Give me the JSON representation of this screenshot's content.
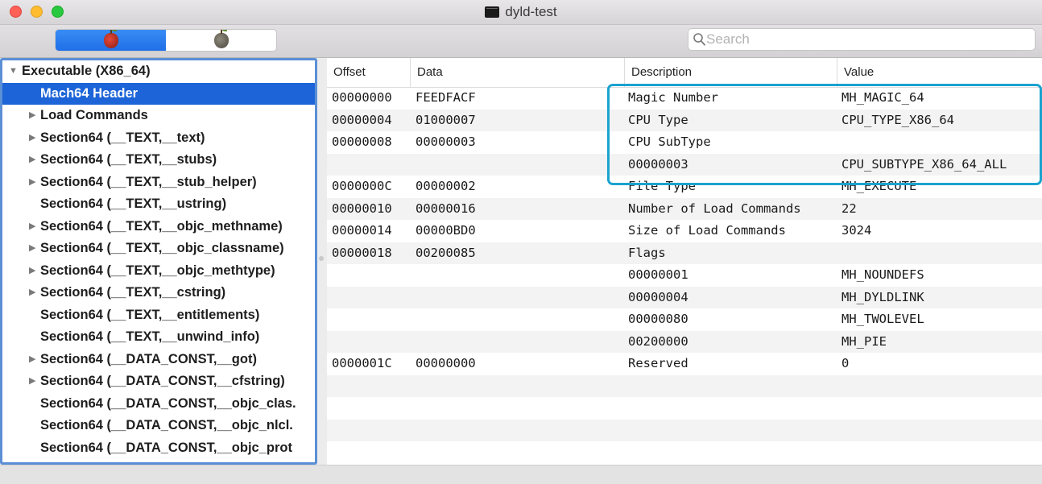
{
  "window": {
    "title": "dyld-test",
    "title_icon": "terminal-icon",
    "traffic_lights": {
      "close": "#fe5f57",
      "minimize": "#febc2e",
      "zoom": "#28c840"
    }
  },
  "toolbar": {
    "segment_left_icon": "red-apple-icon",
    "segment_right_icon": "gray-apple-icon",
    "segment_active_color": "#1f6fe8",
    "search_placeholder": "Search"
  },
  "sidebar": {
    "selection_color": "#1c64d8",
    "items": [
      {
        "label": "Executable  (X86_64)",
        "level": 0,
        "triangle": "▼",
        "selected": false
      },
      {
        "label": "Mach64 Header",
        "level": 1,
        "triangle": "",
        "selected": true
      },
      {
        "label": "Load Commands",
        "level": 1,
        "triangle": "▶",
        "selected": false
      },
      {
        "label": "Section64 (__TEXT,__text)",
        "level": 1,
        "triangle": "▶",
        "selected": false
      },
      {
        "label": "Section64 (__TEXT,__stubs)",
        "level": 1,
        "triangle": "▶",
        "selected": false
      },
      {
        "label": "Section64 (__TEXT,__stub_helper)",
        "level": 1,
        "triangle": "▶",
        "selected": false
      },
      {
        "label": "Section64 (__TEXT,__ustring)",
        "level": 1,
        "triangle": "",
        "selected": false
      },
      {
        "label": "Section64 (__TEXT,__objc_methname)",
        "level": 1,
        "triangle": "▶",
        "selected": false
      },
      {
        "label": "Section64 (__TEXT,__objc_classname)",
        "level": 1,
        "triangle": "▶",
        "selected": false
      },
      {
        "label": "Section64 (__TEXT,__objc_methtype)",
        "level": 1,
        "triangle": "▶",
        "selected": false
      },
      {
        "label": "Section64 (__TEXT,__cstring)",
        "level": 1,
        "triangle": "▶",
        "selected": false
      },
      {
        "label": "Section64 (__TEXT,__entitlements)",
        "level": 1,
        "triangle": "",
        "selected": false
      },
      {
        "label": "Section64 (__TEXT,__unwind_info)",
        "level": 1,
        "triangle": "",
        "selected": false
      },
      {
        "label": "Section64 (__DATA_CONST,__got)",
        "level": 1,
        "triangle": "▶",
        "selected": false
      },
      {
        "label": "Section64 (__DATA_CONST,__cfstring)",
        "level": 1,
        "triangle": "▶",
        "selected": false
      },
      {
        "label": "Section64 (__DATA_CONST,__objc_clas.",
        "level": 1,
        "triangle": "",
        "selected": false
      },
      {
        "label": "Section64 (__DATA_CONST,__objc_nlcl.",
        "level": 1,
        "triangle": "",
        "selected": false
      },
      {
        "label": "Section64 (__DATA_CONST,__objc_prot",
        "level": 1,
        "triangle": "",
        "selected": false
      }
    ]
  },
  "table": {
    "columns": [
      "Offset",
      "Data",
      "Description",
      "Value"
    ],
    "highlight_color": "#1aa3cf",
    "rows": [
      [
        "00000000",
        "FEEDFACF",
        "Magic Number",
        "MH_MAGIC_64"
      ],
      [
        "00000004",
        "01000007",
        "CPU Type",
        "CPU_TYPE_X86_64"
      ],
      [
        "00000008",
        "00000003",
        "CPU SubType",
        ""
      ],
      [
        "",
        "",
        "00000003",
        "CPU_SUBTYPE_X86_64_ALL"
      ],
      [
        "0000000C",
        "00000002",
        "File Type",
        "MH_EXECUTE"
      ],
      [
        "00000010",
        "00000016",
        "Number of Load Commands",
        "22"
      ],
      [
        "00000014",
        "00000BD0",
        "Size of Load Commands",
        "3024"
      ],
      [
        "00000018",
        "00200085",
        "Flags",
        ""
      ],
      [
        "",
        "",
        "00000001",
        "MH_NOUNDEFS"
      ],
      [
        "",
        "",
        "00000004",
        "MH_DYLDLINK"
      ],
      [
        "",
        "",
        "00000080",
        "MH_TWOLEVEL"
      ],
      [
        "",
        "",
        "00200000",
        "MH_PIE"
      ],
      [
        "0000001C",
        "00000000",
        "Reserved",
        "0"
      ],
      [
        "",
        "",
        "",
        ""
      ],
      [
        "",
        "",
        "",
        ""
      ],
      [
        "",
        "",
        "",
        ""
      ]
    ]
  }
}
